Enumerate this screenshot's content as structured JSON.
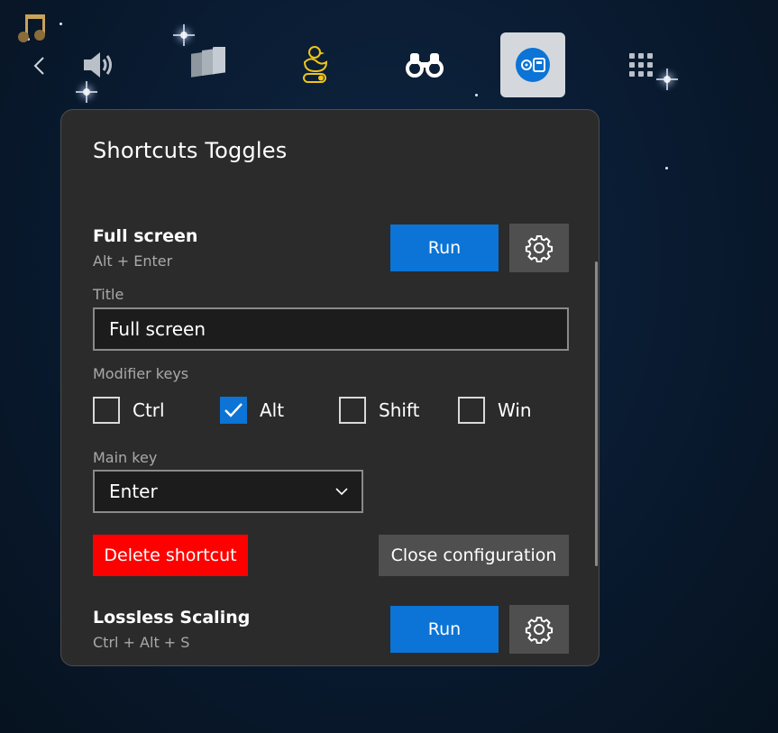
{
  "background": {
    "color": "#0a1c33"
  },
  "topbar": {
    "back_icon": "chevron-left-icon",
    "items": [
      {
        "name": "volume",
        "icon": "speaker-icon"
      },
      {
        "name": "windows",
        "icon": "stacked-windows-icon"
      },
      {
        "name": "duck",
        "icon": "duck-toggle-icon",
        "color": "#f0c419"
      },
      {
        "name": "binoculars",
        "icon": "binoculars-icon"
      },
      {
        "name": "gamepad",
        "icon": "gamepad-switch-icon",
        "active": true,
        "color": "#0b74d6"
      },
      {
        "name": "apps",
        "icon": "grid-dots-icon"
      }
    ]
  },
  "panel": {
    "title": "Shortcuts Toggles",
    "shortcuts": [
      {
        "name": "Full screen",
        "keys": "Alt + Enter",
        "run_label": "Run",
        "expanded": true
      },
      {
        "name": "Lossless Scaling",
        "keys": "Ctrl + Alt + S",
        "run_label": "Run",
        "expanded": false
      }
    ],
    "config": {
      "title_label": "Title",
      "title_value": "Full screen",
      "modifier_label": "Modifier keys",
      "modifiers": [
        {
          "label": "Ctrl",
          "checked": false
        },
        {
          "label": "Alt",
          "checked": true
        },
        {
          "label": "Shift",
          "checked": false
        },
        {
          "label": "Win",
          "checked": false
        }
      ],
      "main_key_label": "Main key",
      "main_key_value": "Enter",
      "delete_label": "Delete shortcut",
      "close_label": "Close configuration"
    }
  },
  "colors": {
    "accent": "#0b74d6",
    "danger": "#ff0000",
    "panel_bg": "#2b2b2b",
    "secondary_button": "#4f4f4f"
  }
}
